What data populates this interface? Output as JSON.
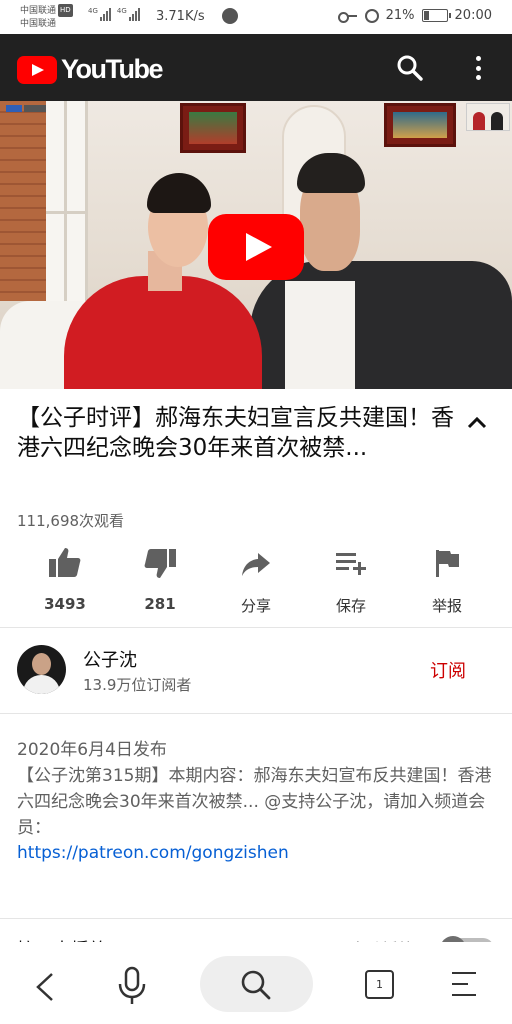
{
  "status_bar": {
    "carrier_1": "中国联通",
    "carrier_2": "中国联通",
    "hd": "HD",
    "network_1": "4G",
    "network_2": "4G",
    "net_speed": "3.71K/s",
    "battery": "21%",
    "time": "20:00"
  },
  "header": {
    "logo_text": "YouTube"
  },
  "video": {
    "title": "【公子时评】郝海东夫妇宣言反共建国！香港六四纪念晚会30年来首次被禁...",
    "views": "111,698次观看"
  },
  "actions": {
    "like_count": "3493",
    "dislike_count": "281",
    "share_label": "分享",
    "save_label": "保存",
    "report_label": "举报"
  },
  "channel": {
    "name": "公子沈",
    "subscribers": "13.9万位订阅者",
    "subscribe_label": "订阅"
  },
  "description": {
    "date": "2020年6月4日发布",
    "body": "【公子沈第315期】本期内容：郝海东夫妇宣布反共建国！香港六四纪念晚会30年来首次被禁... @支持公子沈，请加入频道会员：",
    "link": "https://patreon.com/gongzishen"
  },
  "next_row": {
    "label": "接下来播放",
    "autoplay": "自动播放"
  },
  "bottom_nav": {
    "tab_count": "1"
  },
  "colors": {
    "brand_red": "#ff0000",
    "subscribe_red": "#cc0000",
    "link_blue": "#065fd4",
    "header_bg": "#212121"
  }
}
